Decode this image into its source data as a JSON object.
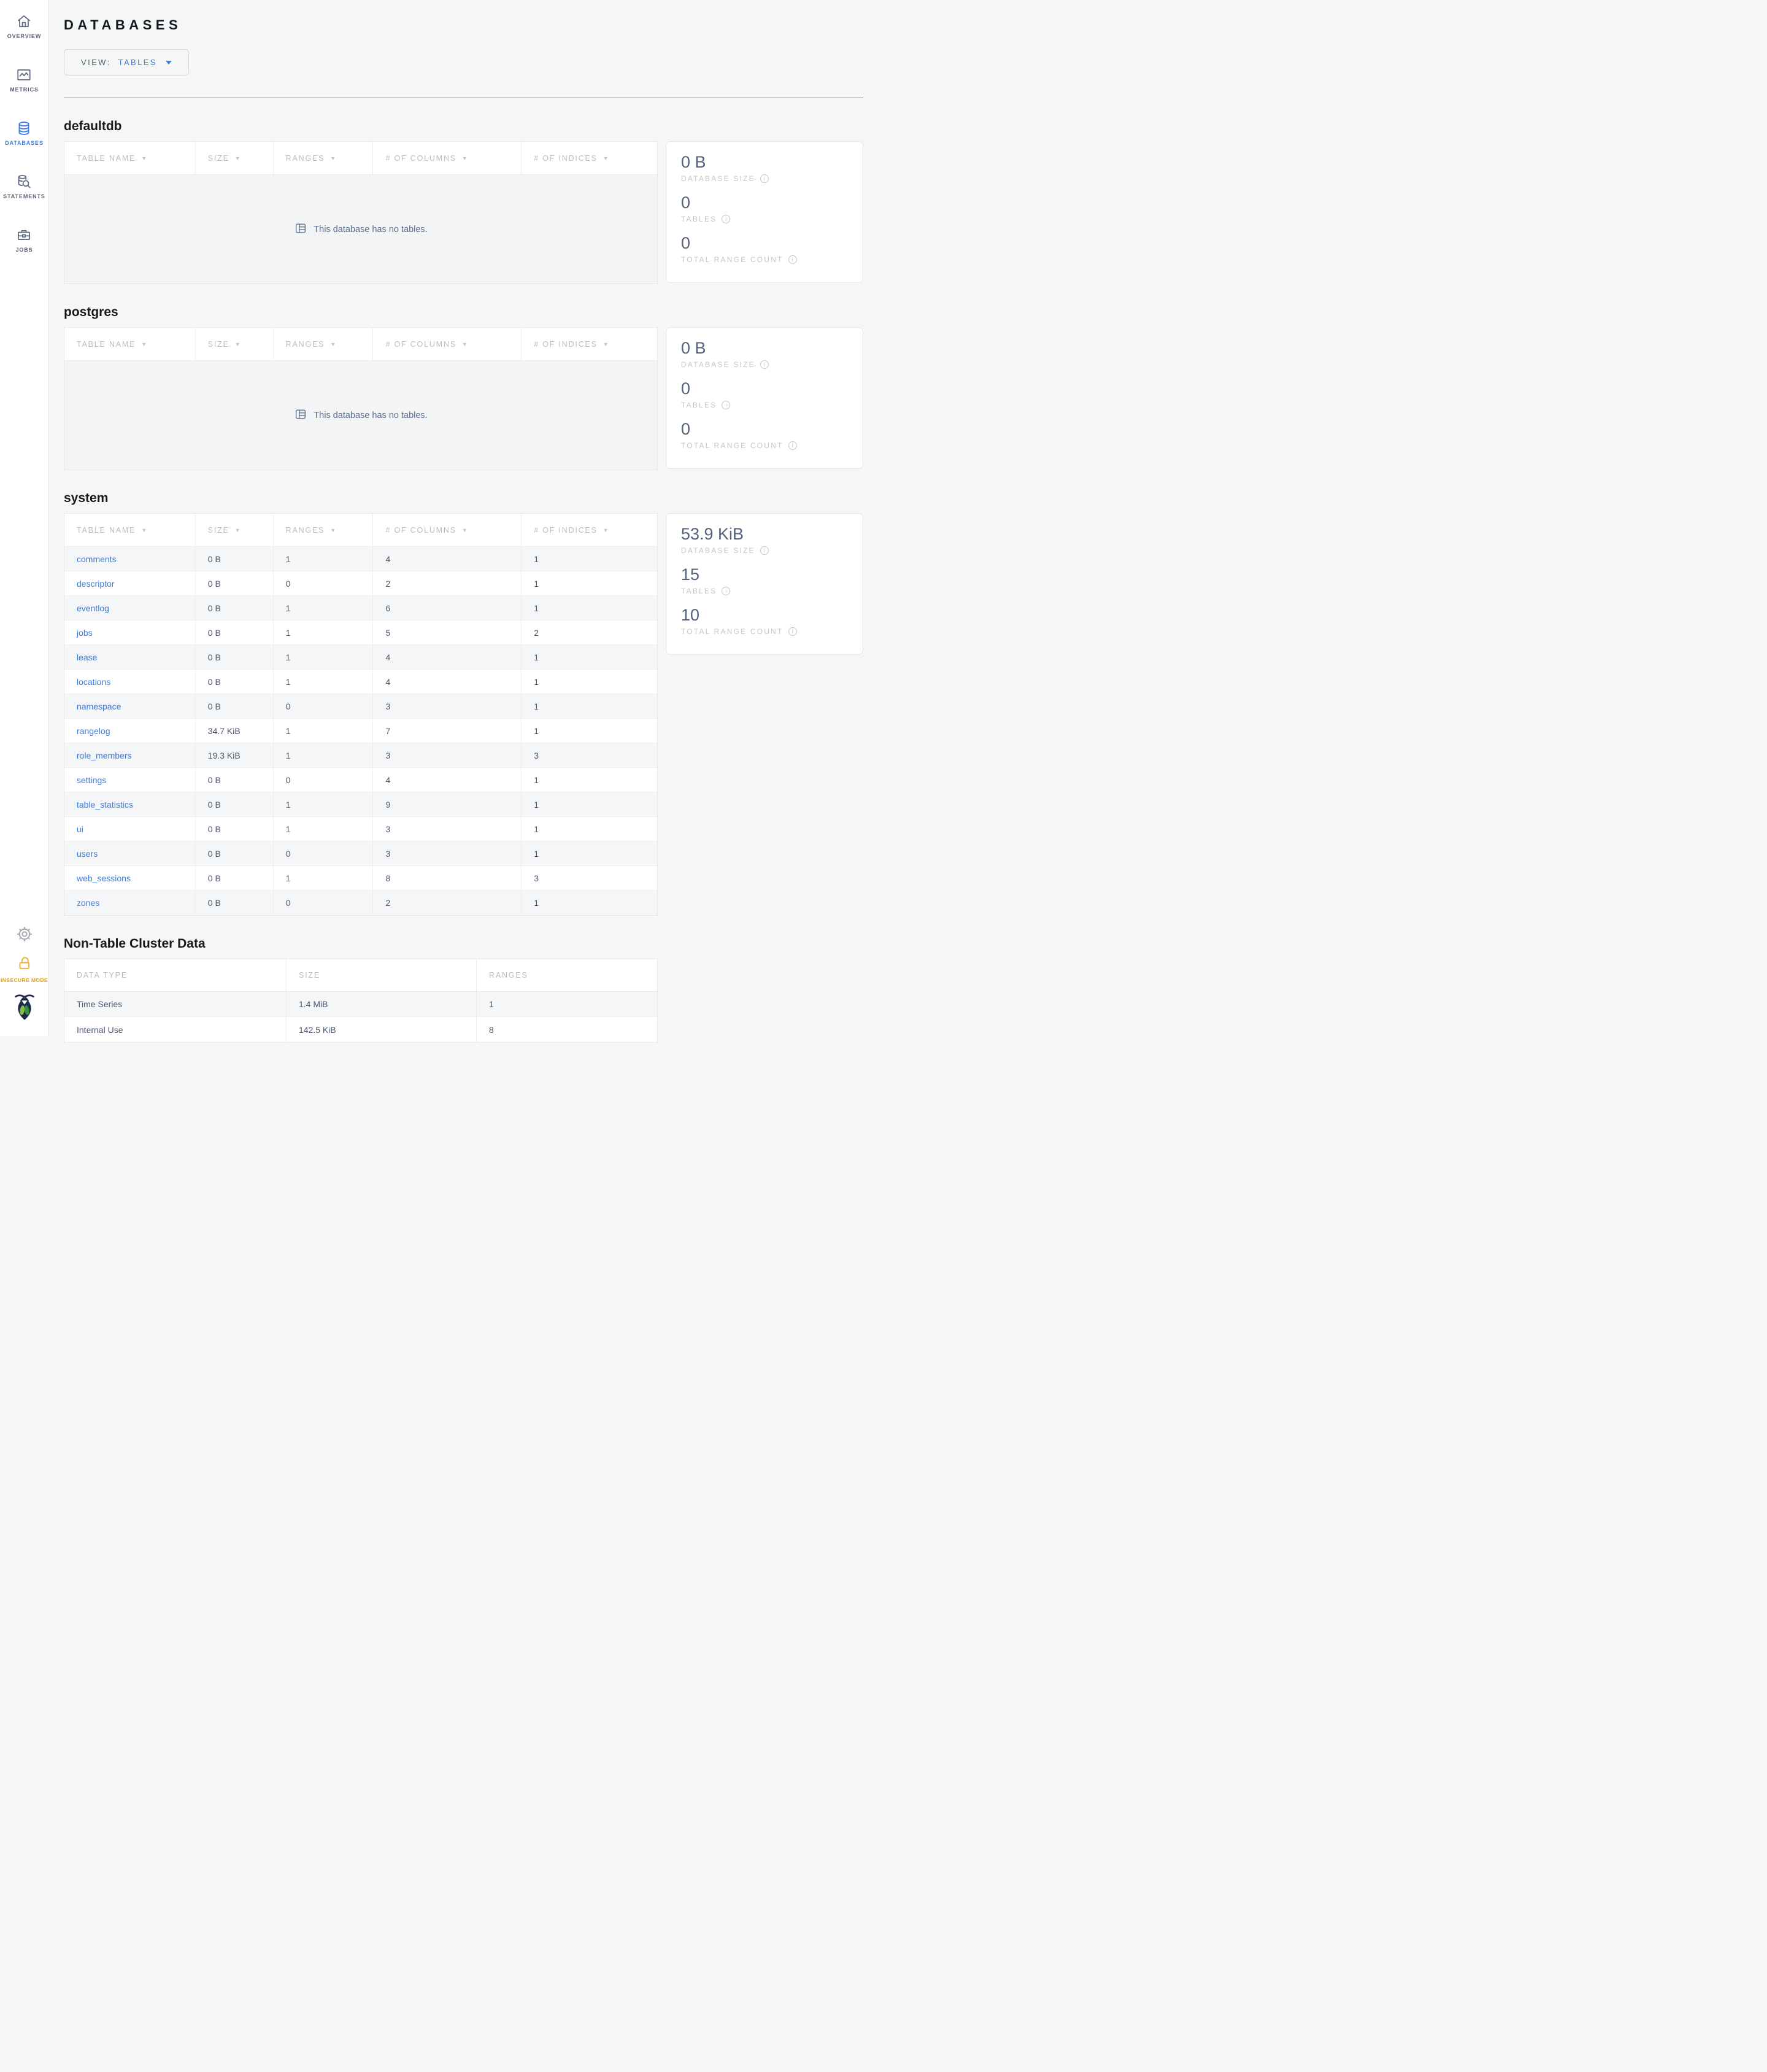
{
  "sidebar": {
    "items": [
      {
        "label": "OVERVIEW",
        "icon": "home-icon",
        "active": false
      },
      {
        "label": "METRICS",
        "icon": "metrics-icon",
        "active": false
      },
      {
        "label": "DATABASES",
        "icon": "databases-icon",
        "active": true
      },
      {
        "label": "STATEMENTS",
        "icon": "statements-icon",
        "active": false
      },
      {
        "label": "JOBS",
        "icon": "jobs-icon",
        "active": false
      }
    ],
    "insecure_mode_label": "INSECURE MODE"
  },
  "header": {
    "title": "DATABASES",
    "view_label": "VIEW:",
    "view_value": "TABLES"
  },
  "table_columns": [
    "TABLE NAME",
    "SIZE",
    "RANGES",
    "# OF COLUMNS",
    "# OF INDICES"
  ],
  "stats_labels": {
    "size": "DATABASE SIZE",
    "tables": "TABLES",
    "ranges": "TOTAL RANGE COUNT"
  },
  "empty_message": "This database has no tables.",
  "databases": [
    {
      "name": "defaultdb",
      "empty": true,
      "stats": {
        "size": "0 B",
        "tables": "0",
        "ranges": "0"
      }
    },
    {
      "name": "postgres",
      "empty": true,
      "stats": {
        "size": "0 B",
        "tables": "0",
        "ranges": "0"
      }
    },
    {
      "name": "system",
      "empty": false,
      "stats": {
        "size": "53.9 KiB",
        "tables": "15",
        "ranges": "10"
      },
      "rows": [
        {
          "name": "comments",
          "size": "0 B",
          "ranges": "1",
          "columns": "4",
          "indices": "1"
        },
        {
          "name": "descriptor",
          "size": "0 B",
          "ranges": "0",
          "columns": "2",
          "indices": "1"
        },
        {
          "name": "eventlog",
          "size": "0 B",
          "ranges": "1",
          "columns": "6",
          "indices": "1"
        },
        {
          "name": "jobs",
          "size": "0 B",
          "ranges": "1",
          "columns": "5",
          "indices": "2"
        },
        {
          "name": "lease",
          "size": "0 B",
          "ranges": "1",
          "columns": "4",
          "indices": "1"
        },
        {
          "name": "locations",
          "size": "0 B",
          "ranges": "1",
          "columns": "4",
          "indices": "1"
        },
        {
          "name": "namespace",
          "size": "0 B",
          "ranges": "0",
          "columns": "3",
          "indices": "1"
        },
        {
          "name": "rangelog",
          "size": "34.7 KiB",
          "ranges": "1",
          "columns": "7",
          "indices": "1"
        },
        {
          "name": "role_members",
          "size": "19.3 KiB",
          "ranges": "1",
          "columns": "3",
          "indices": "3"
        },
        {
          "name": "settings",
          "size": "0 B",
          "ranges": "0",
          "columns": "4",
          "indices": "1"
        },
        {
          "name": "table_statistics",
          "size": "0 B",
          "ranges": "1",
          "columns": "9",
          "indices": "1"
        },
        {
          "name": "ui",
          "size": "0 B",
          "ranges": "1",
          "columns": "3",
          "indices": "1"
        },
        {
          "name": "users",
          "size": "0 B",
          "ranges": "0",
          "columns": "3",
          "indices": "1"
        },
        {
          "name": "web_sessions",
          "size": "0 B",
          "ranges": "1",
          "columns": "8",
          "indices": "3"
        },
        {
          "name": "zones",
          "size": "0 B",
          "ranges": "0",
          "columns": "2",
          "indices": "1"
        }
      ]
    }
  ],
  "non_table": {
    "title": "Non-Table Cluster Data",
    "columns": [
      "DATA TYPE",
      "SIZE",
      "RANGES"
    ],
    "rows": [
      {
        "type": "Time Series",
        "size": "1.4 MiB",
        "ranges": "1"
      },
      {
        "type": "Internal Use",
        "size": "142.5 KiB",
        "ranges": "8"
      }
    ]
  },
  "colors": {
    "accent_blue": "#3b7ddd",
    "stat_number": "#55627c",
    "label_gray": "#c3c6cb",
    "insecure_yellow": "#dfa621",
    "logo_navy": "#1c2b49",
    "logo_green_light": "#85bf4c",
    "logo_green_dark": "#389140"
  }
}
